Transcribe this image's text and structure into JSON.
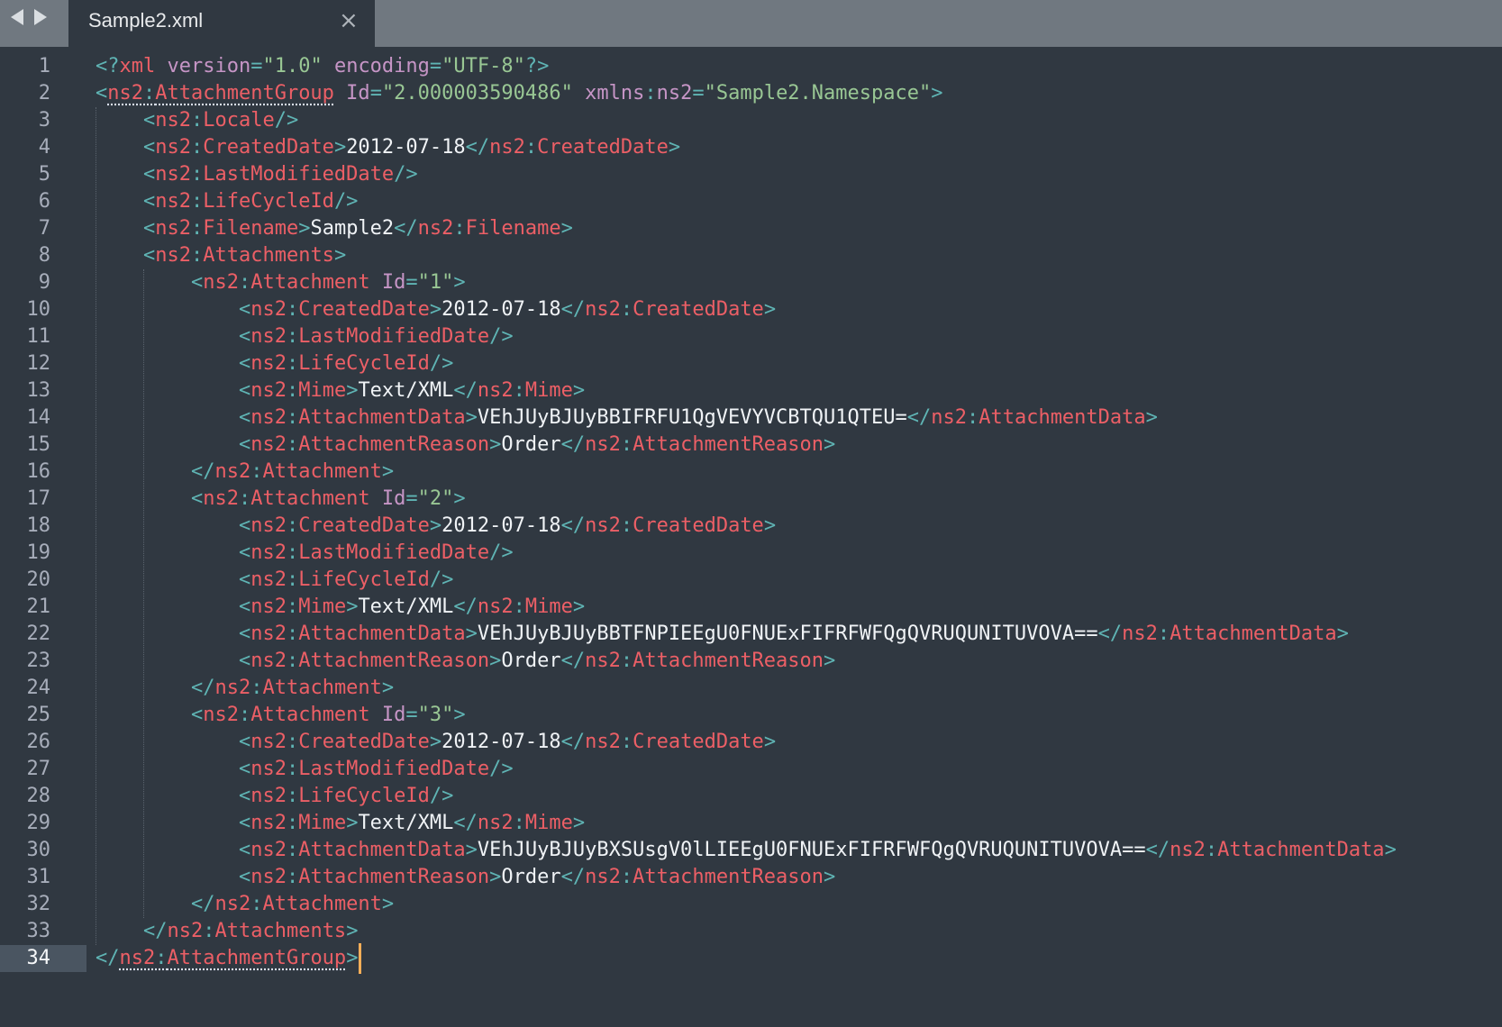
{
  "tab": {
    "title": "Sample2.xml",
    "close_glyph": "×"
  },
  "icons": {
    "nav_back": "nav-back-icon",
    "nav_forward": "nav-forward-icon",
    "close": "close-icon"
  },
  "colors": {
    "background": "#303841",
    "tabbar": "#707880",
    "punctuation": "#5fb4b4",
    "tag": "#ec5f66",
    "attribute": "#c695c6",
    "value": "#99c794",
    "text": "#f0f3f6",
    "cursor": "#f9ae58",
    "active_line": "#4a5561"
  },
  "editor": {
    "active_line": 34,
    "lines": [
      [
        [
          "p",
          "<?"
        ],
        [
          "t",
          "xml"
        ],
        [
          "a",
          " version"
        ],
        [
          "p",
          "="
        ],
        [
          "v",
          "\"1.0\""
        ],
        [
          "a",
          " encoding"
        ],
        [
          "p",
          "="
        ],
        [
          "v",
          "\"UTF-8\""
        ],
        [
          "p",
          "?>"
        ]
      ],
      [
        [
          "p",
          "<"
        ],
        [
          "tu",
          "ns2"
        ],
        [
          "pu",
          ":"
        ],
        [
          "tu",
          "AttachmentGroup"
        ],
        [
          "a",
          " Id"
        ],
        [
          "p",
          "="
        ],
        [
          "v",
          "\"2.000003590486\""
        ],
        [
          "a",
          " xmlns"
        ],
        [
          "p",
          ":"
        ],
        [
          "a",
          "ns2"
        ],
        [
          "p",
          "="
        ],
        [
          "v",
          "\"Sample2.Namespace\""
        ],
        [
          "p",
          ">"
        ]
      ],
      [
        [
          "s",
          "    "
        ],
        [
          "p",
          "<"
        ],
        [
          "t",
          "ns2"
        ],
        [
          "p",
          ":"
        ],
        [
          "t",
          "Locale"
        ],
        [
          "p",
          "/>"
        ]
      ],
      [
        [
          "s",
          "    "
        ],
        [
          "p",
          "<"
        ],
        [
          "t",
          "ns2"
        ],
        [
          "p",
          ":"
        ],
        [
          "t",
          "CreatedDate"
        ],
        [
          "p",
          ">"
        ],
        [
          "x",
          "2012-07-18"
        ],
        [
          "p",
          "</"
        ],
        [
          "t",
          "ns2"
        ],
        [
          "p",
          ":"
        ],
        [
          "t",
          "CreatedDate"
        ],
        [
          "p",
          ">"
        ]
      ],
      [
        [
          "s",
          "    "
        ],
        [
          "p",
          "<"
        ],
        [
          "t",
          "ns2"
        ],
        [
          "p",
          ":"
        ],
        [
          "t",
          "LastModifiedDate"
        ],
        [
          "p",
          "/>"
        ]
      ],
      [
        [
          "s",
          "    "
        ],
        [
          "p",
          "<"
        ],
        [
          "t",
          "ns2"
        ],
        [
          "p",
          ":"
        ],
        [
          "t",
          "LifeCycleId"
        ],
        [
          "p",
          "/>"
        ]
      ],
      [
        [
          "s",
          "    "
        ],
        [
          "p",
          "<"
        ],
        [
          "t",
          "ns2"
        ],
        [
          "p",
          ":"
        ],
        [
          "t",
          "Filename"
        ],
        [
          "p",
          ">"
        ],
        [
          "x",
          "Sample2"
        ],
        [
          "p",
          "</"
        ],
        [
          "t",
          "ns2"
        ],
        [
          "p",
          ":"
        ],
        [
          "t",
          "Filename"
        ],
        [
          "p",
          ">"
        ]
      ],
      [
        [
          "s",
          "    "
        ],
        [
          "p",
          "<"
        ],
        [
          "t",
          "ns2"
        ],
        [
          "p",
          ":"
        ],
        [
          "t",
          "Attachments"
        ],
        [
          "p",
          ">"
        ]
      ],
      [
        [
          "s",
          "        "
        ],
        [
          "p",
          "<"
        ],
        [
          "t",
          "ns2"
        ],
        [
          "p",
          ":"
        ],
        [
          "t",
          "Attachment"
        ],
        [
          "a",
          " Id"
        ],
        [
          "p",
          "="
        ],
        [
          "v",
          "\"1\""
        ],
        [
          "p",
          ">"
        ]
      ],
      [
        [
          "s",
          "            "
        ],
        [
          "p",
          "<"
        ],
        [
          "t",
          "ns2"
        ],
        [
          "p",
          ":"
        ],
        [
          "t",
          "CreatedDate"
        ],
        [
          "p",
          ">"
        ],
        [
          "x",
          "2012-07-18"
        ],
        [
          "p",
          "</"
        ],
        [
          "t",
          "ns2"
        ],
        [
          "p",
          ":"
        ],
        [
          "t",
          "CreatedDate"
        ],
        [
          "p",
          ">"
        ]
      ],
      [
        [
          "s",
          "            "
        ],
        [
          "p",
          "<"
        ],
        [
          "t",
          "ns2"
        ],
        [
          "p",
          ":"
        ],
        [
          "t",
          "LastModifiedDate"
        ],
        [
          "p",
          "/>"
        ]
      ],
      [
        [
          "s",
          "            "
        ],
        [
          "p",
          "<"
        ],
        [
          "t",
          "ns2"
        ],
        [
          "p",
          ":"
        ],
        [
          "t",
          "LifeCycleId"
        ],
        [
          "p",
          "/>"
        ]
      ],
      [
        [
          "s",
          "            "
        ],
        [
          "p",
          "<"
        ],
        [
          "t",
          "ns2"
        ],
        [
          "p",
          ":"
        ],
        [
          "t",
          "Mime"
        ],
        [
          "p",
          ">"
        ],
        [
          "x",
          "Text/XML"
        ],
        [
          "p",
          "</"
        ],
        [
          "t",
          "ns2"
        ],
        [
          "p",
          ":"
        ],
        [
          "t",
          "Mime"
        ],
        [
          "p",
          ">"
        ]
      ],
      [
        [
          "s",
          "            "
        ],
        [
          "p",
          "<"
        ],
        [
          "t",
          "ns2"
        ],
        [
          "p",
          ":"
        ],
        [
          "t",
          "AttachmentData"
        ],
        [
          "p",
          ">"
        ],
        [
          "x",
          "VEhJUyBJUyBBIFRFU1QgVEVYVCBTQU1QTEU="
        ],
        [
          "p",
          "</"
        ],
        [
          "t",
          "ns2"
        ],
        [
          "p",
          ":"
        ],
        [
          "t",
          "AttachmentData"
        ],
        [
          "p",
          ">"
        ]
      ],
      [
        [
          "s",
          "            "
        ],
        [
          "p",
          "<"
        ],
        [
          "t",
          "ns2"
        ],
        [
          "p",
          ":"
        ],
        [
          "t",
          "AttachmentReason"
        ],
        [
          "p",
          ">"
        ],
        [
          "x",
          "Order"
        ],
        [
          "p",
          "</"
        ],
        [
          "t",
          "ns2"
        ],
        [
          "p",
          ":"
        ],
        [
          "t",
          "AttachmentReason"
        ],
        [
          "p",
          ">"
        ]
      ],
      [
        [
          "s",
          "        "
        ],
        [
          "p",
          "</"
        ],
        [
          "t",
          "ns2"
        ],
        [
          "p",
          ":"
        ],
        [
          "t",
          "Attachment"
        ],
        [
          "p",
          ">"
        ]
      ],
      [
        [
          "s",
          "        "
        ],
        [
          "p",
          "<"
        ],
        [
          "t",
          "ns2"
        ],
        [
          "p",
          ":"
        ],
        [
          "t",
          "Attachment"
        ],
        [
          "a",
          " Id"
        ],
        [
          "p",
          "="
        ],
        [
          "v",
          "\"2\""
        ],
        [
          "p",
          ">"
        ]
      ],
      [
        [
          "s",
          "            "
        ],
        [
          "p",
          "<"
        ],
        [
          "t",
          "ns2"
        ],
        [
          "p",
          ":"
        ],
        [
          "t",
          "CreatedDate"
        ],
        [
          "p",
          ">"
        ],
        [
          "x",
          "2012-07-18"
        ],
        [
          "p",
          "</"
        ],
        [
          "t",
          "ns2"
        ],
        [
          "p",
          ":"
        ],
        [
          "t",
          "CreatedDate"
        ],
        [
          "p",
          ">"
        ]
      ],
      [
        [
          "s",
          "            "
        ],
        [
          "p",
          "<"
        ],
        [
          "t",
          "ns2"
        ],
        [
          "p",
          ":"
        ],
        [
          "t",
          "LastModifiedDate"
        ],
        [
          "p",
          "/>"
        ]
      ],
      [
        [
          "s",
          "            "
        ],
        [
          "p",
          "<"
        ],
        [
          "t",
          "ns2"
        ],
        [
          "p",
          ":"
        ],
        [
          "t",
          "LifeCycleId"
        ],
        [
          "p",
          "/>"
        ]
      ],
      [
        [
          "s",
          "            "
        ],
        [
          "p",
          "<"
        ],
        [
          "t",
          "ns2"
        ],
        [
          "p",
          ":"
        ],
        [
          "t",
          "Mime"
        ],
        [
          "p",
          ">"
        ],
        [
          "x",
          "Text/XML"
        ],
        [
          "p",
          "</"
        ],
        [
          "t",
          "ns2"
        ],
        [
          "p",
          ":"
        ],
        [
          "t",
          "Mime"
        ],
        [
          "p",
          ">"
        ]
      ],
      [
        [
          "s",
          "            "
        ],
        [
          "p",
          "<"
        ],
        [
          "t",
          "ns2"
        ],
        [
          "p",
          ":"
        ],
        [
          "t",
          "AttachmentData"
        ],
        [
          "p",
          ">"
        ],
        [
          "x",
          "VEhJUyBJUyBBTFNPIEEgU0FNUExFIFRFWFQgQVRUQUNITUVOVA=="
        ],
        [
          "p",
          "</"
        ],
        [
          "t",
          "ns2"
        ],
        [
          "p",
          ":"
        ],
        [
          "t",
          "AttachmentData"
        ],
        [
          "p",
          ">"
        ]
      ],
      [
        [
          "s",
          "            "
        ],
        [
          "p",
          "<"
        ],
        [
          "t",
          "ns2"
        ],
        [
          "p",
          ":"
        ],
        [
          "t",
          "AttachmentReason"
        ],
        [
          "p",
          ">"
        ],
        [
          "x",
          "Order"
        ],
        [
          "p",
          "</"
        ],
        [
          "t",
          "ns2"
        ],
        [
          "p",
          ":"
        ],
        [
          "t",
          "AttachmentReason"
        ],
        [
          "p",
          ">"
        ]
      ],
      [
        [
          "s",
          "        "
        ],
        [
          "p",
          "</"
        ],
        [
          "t",
          "ns2"
        ],
        [
          "p",
          ":"
        ],
        [
          "t",
          "Attachment"
        ],
        [
          "p",
          ">"
        ]
      ],
      [
        [
          "s",
          "        "
        ],
        [
          "p",
          "<"
        ],
        [
          "t",
          "ns2"
        ],
        [
          "p",
          ":"
        ],
        [
          "t",
          "Attachment"
        ],
        [
          "a",
          " Id"
        ],
        [
          "p",
          "="
        ],
        [
          "v",
          "\"3\""
        ],
        [
          "p",
          ">"
        ]
      ],
      [
        [
          "s",
          "            "
        ],
        [
          "p",
          "<"
        ],
        [
          "t",
          "ns2"
        ],
        [
          "p",
          ":"
        ],
        [
          "t",
          "CreatedDate"
        ],
        [
          "p",
          ">"
        ],
        [
          "x",
          "2012-07-18"
        ],
        [
          "p",
          "</"
        ],
        [
          "t",
          "ns2"
        ],
        [
          "p",
          ":"
        ],
        [
          "t",
          "CreatedDate"
        ],
        [
          "p",
          ">"
        ]
      ],
      [
        [
          "s",
          "            "
        ],
        [
          "p",
          "<"
        ],
        [
          "t",
          "ns2"
        ],
        [
          "p",
          ":"
        ],
        [
          "t",
          "LastModifiedDate"
        ],
        [
          "p",
          "/>"
        ]
      ],
      [
        [
          "s",
          "            "
        ],
        [
          "p",
          "<"
        ],
        [
          "t",
          "ns2"
        ],
        [
          "p",
          ":"
        ],
        [
          "t",
          "LifeCycleId"
        ],
        [
          "p",
          "/>"
        ]
      ],
      [
        [
          "s",
          "            "
        ],
        [
          "p",
          "<"
        ],
        [
          "t",
          "ns2"
        ],
        [
          "p",
          ":"
        ],
        [
          "t",
          "Mime"
        ],
        [
          "p",
          ">"
        ],
        [
          "x",
          "Text/XML"
        ],
        [
          "p",
          "</"
        ],
        [
          "t",
          "ns2"
        ],
        [
          "p",
          ":"
        ],
        [
          "t",
          "Mime"
        ],
        [
          "p",
          ">"
        ]
      ],
      [
        [
          "s",
          "            "
        ],
        [
          "p",
          "<"
        ],
        [
          "t",
          "ns2"
        ],
        [
          "p",
          ":"
        ],
        [
          "t",
          "AttachmentData"
        ],
        [
          "p",
          ">"
        ],
        [
          "x",
          "VEhJUyBJUyBXSUsgV0lLIEEgU0FNUExFIFRFWFQgQVRUQUNITUVOVA=="
        ],
        [
          "p",
          "</"
        ],
        [
          "t",
          "ns2"
        ],
        [
          "p",
          ":"
        ],
        [
          "t",
          "AttachmentData"
        ],
        [
          "p",
          ">"
        ]
      ],
      [
        [
          "s",
          "            "
        ],
        [
          "p",
          "<"
        ],
        [
          "t",
          "ns2"
        ],
        [
          "p",
          ":"
        ],
        [
          "t",
          "AttachmentReason"
        ],
        [
          "p",
          ">"
        ],
        [
          "x",
          "Order"
        ],
        [
          "p",
          "</"
        ],
        [
          "t",
          "ns2"
        ],
        [
          "p",
          ":"
        ],
        [
          "t",
          "AttachmentReason"
        ],
        [
          "p",
          ">"
        ]
      ],
      [
        [
          "s",
          "        "
        ],
        [
          "p",
          "</"
        ],
        [
          "t",
          "ns2"
        ],
        [
          "p",
          ":"
        ],
        [
          "t",
          "Attachment"
        ],
        [
          "p",
          ">"
        ]
      ],
      [
        [
          "s",
          "    "
        ],
        [
          "p",
          "</"
        ],
        [
          "t",
          "ns2"
        ],
        [
          "p",
          ":"
        ],
        [
          "t",
          "Attachments"
        ],
        [
          "p",
          ">"
        ]
      ],
      [
        [
          "p",
          "</"
        ],
        [
          "tu",
          "ns2"
        ],
        [
          "pu",
          ":"
        ],
        [
          "tu",
          "AttachmentGroup"
        ],
        [
          "p",
          ">"
        ]
      ]
    ]
  }
}
